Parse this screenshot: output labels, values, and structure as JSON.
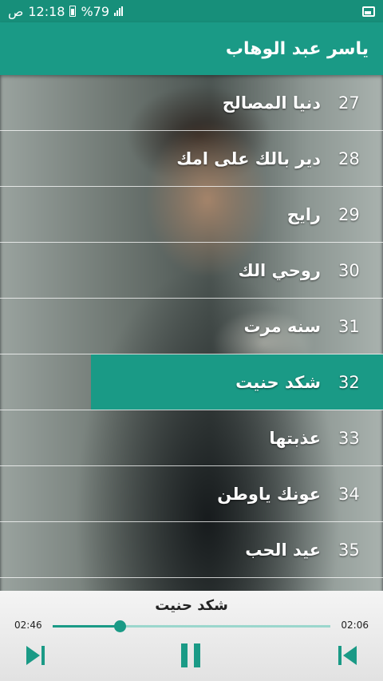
{
  "status": {
    "time": "12:18",
    "ampm": "ص",
    "battery": "%79"
  },
  "app": {
    "title": "ياسر عبد الوهاب"
  },
  "songs": [
    {
      "num": "27",
      "title": "دنيا المصالح"
    },
    {
      "num": "28",
      "title": "دير بالك على امك"
    },
    {
      "num": "29",
      "title": "رايح"
    },
    {
      "num": "30",
      "title": "روحي الك"
    },
    {
      "num": "31",
      "title": "سنه مرت"
    },
    {
      "num": "32",
      "title": "شكد حنيت"
    },
    {
      "num": "33",
      "title": "عذبتها"
    },
    {
      "num": "34",
      "title": "عونك ياوطن"
    },
    {
      "num": "35",
      "title": "عيد الحب"
    }
  ],
  "active_index": 5,
  "player": {
    "title": "شكد حنيت",
    "elapsed": "02:46",
    "remaining": "02:06",
    "progress": 0.24
  },
  "colors": {
    "accent": "#1a9a86",
    "statusbar": "#178f7a"
  },
  "icons": {
    "next": "skip-next-icon",
    "pause": "pause-icon",
    "prev": "skip-previous-icon"
  }
}
